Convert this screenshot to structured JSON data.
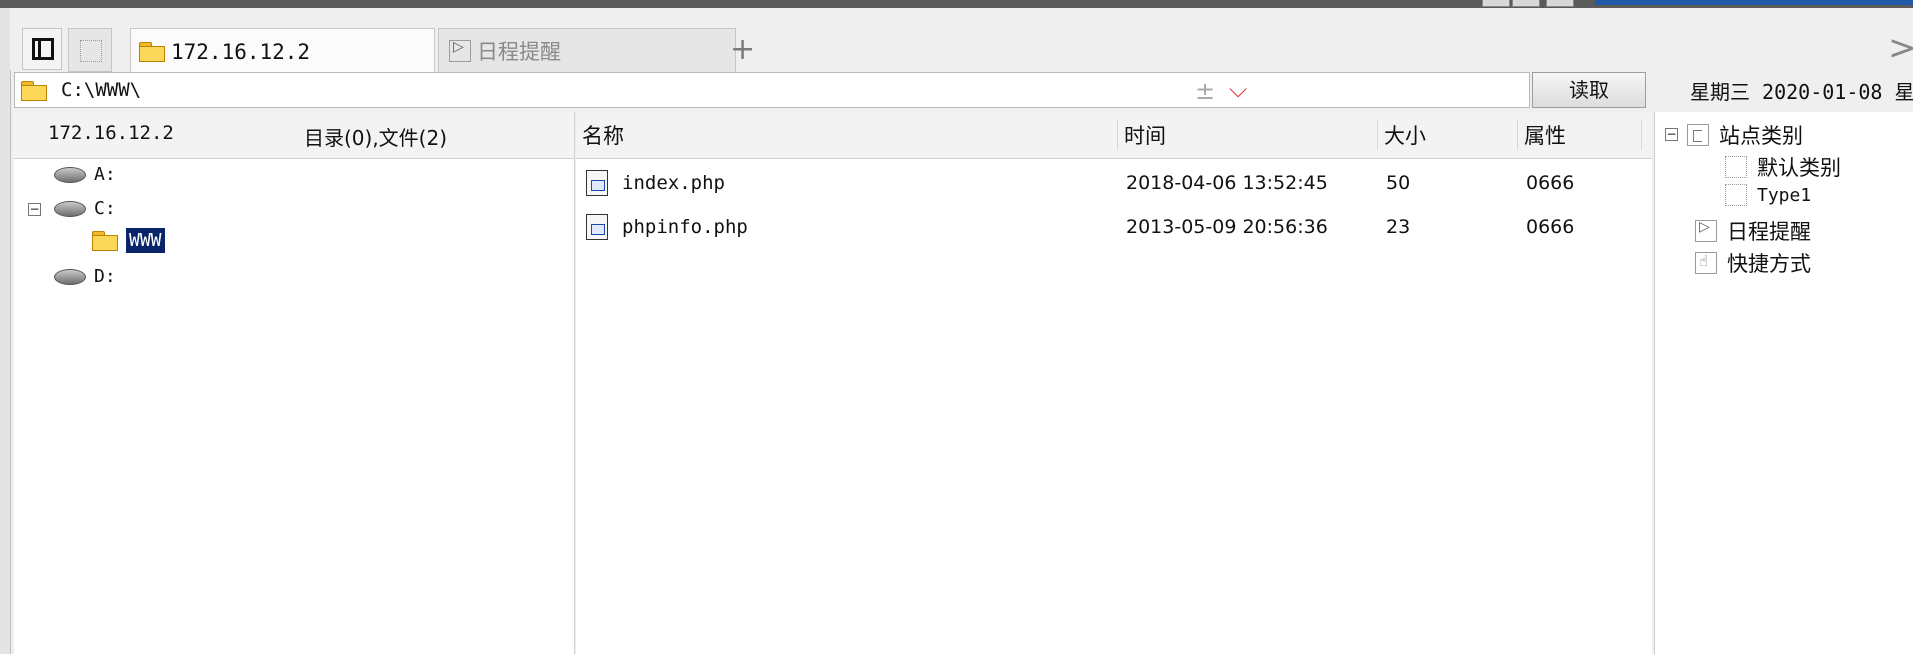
{
  "tabs": [
    {
      "label": "172.16.12.2",
      "icon": "folder-icon",
      "active": true
    },
    {
      "label": "日程提醒",
      "icon": "clock-icon",
      "active": false
    }
  ],
  "address": {
    "path": "C:\\WWW\\",
    "plusminus": "±",
    "dropdown": "⌵"
  },
  "read_button": "读取",
  "date_display": "星期三 2020-01-08 星",
  "tree": {
    "host": "172.16.12.2",
    "summary": "目录(0),文件(2)",
    "drives": [
      "A:",
      "C:",
      "D:"
    ],
    "selected_folder": "WWW"
  },
  "file_list": {
    "columns": [
      "名称",
      "时间",
      "大小",
      "属性"
    ],
    "rows": [
      {
        "name": "index.php",
        "time": "2018-04-06 13:52:45",
        "size": "50",
        "attr": "0666"
      },
      {
        "name": "phpinfo.php",
        "time": "2013-05-09 20:56:36",
        "size": "23",
        "attr": "0666"
      }
    ]
  },
  "site_tree": {
    "root": "站点类别",
    "children": [
      "默认类别",
      "Type1"
    ],
    "reminder": "日程提醒",
    "shortcut": "快捷方式"
  },
  "colors": {
    "selection": "#0a246a",
    "dropdown_arrow": "#e23b3b",
    "folder": "#fcd85a"
  }
}
